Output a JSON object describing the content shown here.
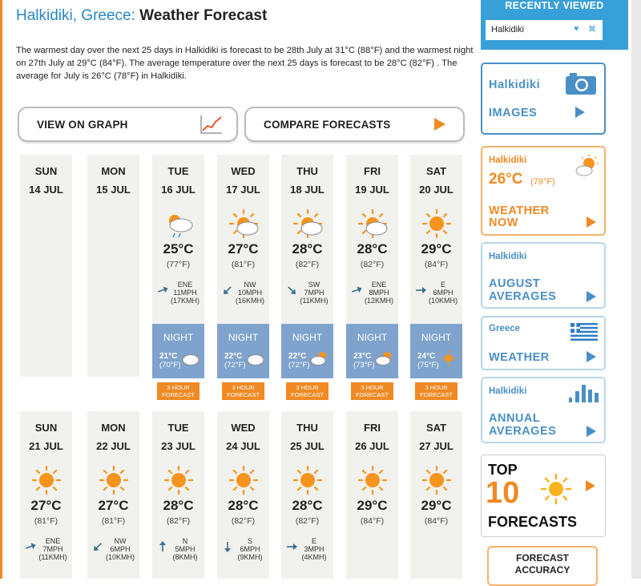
{
  "page": {
    "location": "Halkidiki, Greece:",
    "heading": "Weather Forecast",
    "intro": "The warmest day over the next 25 days in Halkidiki is forecast to be 28th July at 31°C (88°F) and the warmest night on 27th July at 29°C (84°F). The average temperature over the next 25 days is forecast to be 28°C (82°F) . The average for July is 26°C (78°F) in Halkidiki."
  },
  "buttons": {
    "graph": "VIEW ON GRAPH",
    "compare": "COMPARE FORECASTS"
  },
  "labels": {
    "night": "NIGHT",
    "three_hour": [
      "3 HOUR",
      "FORECAST"
    ]
  },
  "colors": {
    "accent_orange": "#f08a24",
    "accent_blue": "#4a8fc6",
    "night_bg": "#7fa3cc",
    "day_bg": "#f1f1ed"
  },
  "week1": [
    {
      "day": "SUN",
      "date": "14 JUL",
      "icon": "none"
    },
    {
      "day": "MON",
      "date": "15 JUL",
      "icon": "none"
    },
    {
      "day": "TUE",
      "date": "16 JUL",
      "icon": "cloud-sun-rain-icon",
      "tc": "25°C",
      "tf": "(77°F)",
      "dir": "ENE",
      "mph": "11MPH",
      "kmh": "(17KMH)",
      "nc": "21°C",
      "nf": "(70°F)",
      "nicon": "cloud-icon"
    },
    {
      "day": "WED",
      "date": "17 JUL",
      "icon": "cloud-sun-icon",
      "tc": "27°C",
      "tf": "(81°F)",
      "dir": "NW",
      "mph": "10MPH",
      "kmh": "(16KMH)",
      "nc": "22°C",
      "nf": "(72°F)",
      "nicon": "cloud-icon"
    },
    {
      "day": "THU",
      "date": "18 JUL",
      "icon": "cloud-sun-icon",
      "tc": "28°C",
      "tf": "(82°F)",
      "dir": "SW",
      "mph": "7MPH",
      "kmh": "(11KMH)",
      "nc": "22°C",
      "nf": "(72°F)",
      "nicon": "cloud-sun-icon"
    },
    {
      "day": "FRI",
      "date": "19 JUL",
      "icon": "sun-cloud-icon",
      "tc": "28°C",
      "tf": "(82°F)",
      "dir": "ENE",
      "mph": "8MPH",
      "kmh": "(12KMH)",
      "nc": "23°C",
      "nf": "(73°F)",
      "nicon": "cloud-sun-icon"
    },
    {
      "day": "SAT",
      "date": "20 JUL",
      "icon": "sun-icon",
      "tc": "29°C",
      "tf": "(84°F)",
      "dir": "E",
      "mph": "6MPH",
      "kmh": "(10KMH)",
      "nc": "24°C",
      "nf": "(75°F)",
      "nicon": "sun-icon"
    }
  ],
  "week2": [
    {
      "day": "SUN",
      "date": "21 JUL",
      "icon": "sun-icon",
      "tc": "27°C",
      "tf": "(81°F)",
      "dir": "ENE",
      "mph": "7MPH",
      "kmh": "(11KMH)"
    },
    {
      "day": "MON",
      "date": "22 JUL",
      "icon": "sun-icon",
      "tc": "27°C",
      "tf": "(81°F)",
      "dir": "NW",
      "mph": "6MPH",
      "kmh": "(10KMH)"
    },
    {
      "day": "TUE",
      "date": "23 JUL",
      "icon": "sun-icon",
      "tc": "28°C",
      "tf": "(82°F)",
      "dir": "N",
      "mph": "5MPH",
      "kmh": "(8KMH)"
    },
    {
      "day": "WED",
      "date": "24 JUL",
      "icon": "sun-icon",
      "tc": "28°C",
      "tf": "(82°F)",
      "dir": "S",
      "mph": "6MPH",
      "kmh": "(9KMH)"
    },
    {
      "day": "THU",
      "date": "25 JUL",
      "icon": "sun-icon",
      "tc": "28°C",
      "tf": "(82°F)",
      "dir": "E",
      "mph": "3MPH",
      "kmh": "(4KMH)"
    },
    {
      "day": "FRI",
      "date": "26 JUL",
      "icon": "sun-icon",
      "tc": "29°C",
      "tf": "(84°F)"
    },
    {
      "day": "SAT",
      "date": "27 JUL",
      "icon": "sun-icon",
      "tc": "29°C",
      "tf": "(84°F)"
    }
  ],
  "sidebar": {
    "recent_title": "RECENTLY VIEWED",
    "recent_item": "Halkidiki",
    "images_place": "Halkidiki",
    "images_label": "IMAGES",
    "now_place": "Halkidiki",
    "now_temp": "26°C",
    "now_temp_f": "(79°F)",
    "now_label": [
      "WEATHER",
      "NOW"
    ],
    "aug_place": "Halkidiki",
    "aug_label": [
      "AUGUST",
      "AVERAGES"
    ],
    "greece_place": "Greece",
    "greece_label": "WEATHER",
    "annual_place": "Halkidiki",
    "annual_label": [
      "ANNUAL",
      "AVERAGES"
    ],
    "top_a": "TOP",
    "top_n": "10",
    "top_c": "FORECASTS",
    "accuracy": [
      "FORECAST",
      "ACCURACY"
    ]
  }
}
